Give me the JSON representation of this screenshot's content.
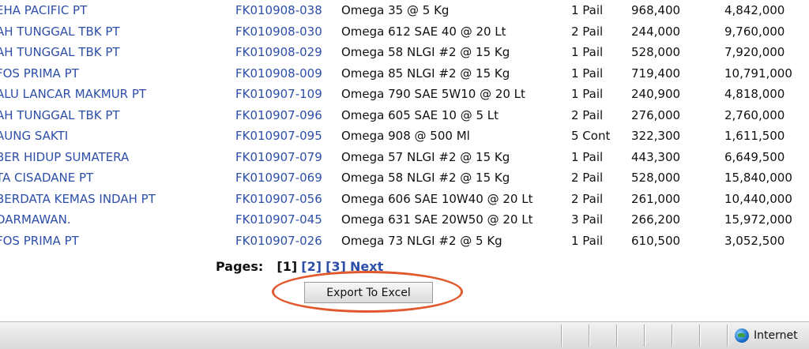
{
  "rows": [
    {
      "customer": "EHA PACIFIC PT",
      "invoice": "FK010908-038",
      "product": "Omega 35 @ 5 Kg",
      "qty": "1 Pail",
      "price": "968,400",
      "total": "4,842,000"
    },
    {
      "customer": "AH TUNGGAL TBK PT",
      "invoice": "FK010908-030",
      "product": "Omega 612 SAE 40 @ 20 Lt",
      "qty": "2 Pail",
      "price": "244,000",
      "total": "9,760,000"
    },
    {
      "customer": "AH TUNGGAL TBK PT",
      "invoice": "FK010908-029",
      "product": "Omega 58 NLGI #2 @ 15 Kg",
      "qty": "1 Pail",
      "price": "528,000",
      "total": "7,920,000"
    },
    {
      "customer": "FOS PRIMA PT",
      "invoice": "FK010908-009",
      "product": "Omega 85 NLGI #2 @ 15 Kg",
      "qty": "1 Pail",
      "price": "719,400",
      "total": "10,791,000"
    },
    {
      "customer": "ALU LANCAR MAKMUR PT",
      "invoice": "FK010907-109",
      "product": "Omega 790 SAE 5W10 @ 20 Lt",
      "qty": "1 Pail",
      "price": "240,900",
      "total": "4,818,000"
    },
    {
      "customer": "AH TUNGGAL TBK PT",
      "invoice": "FK010907-096",
      "product": "Omega 605 SAE 10 @ 5 Lt",
      "qty": "2 Pail",
      "price": "276,000",
      "total": "2,760,000"
    },
    {
      "customer": "AUNG SAKTI",
      "invoice": "FK010907-095",
      "product": "Omega 908 @ 500 Ml",
      "qty": "5 Cont",
      "price": "322,300",
      "total": "1,611,500"
    },
    {
      "customer": "BER HIDUP SUMATERA",
      "invoice": "FK010907-079",
      "product": "Omega 57 NLGI #2 @ 15 Kg",
      "qty": "1 Pail",
      "price": "443,300",
      "total": "6,649,500"
    },
    {
      "customer": "TA CISADANE PT",
      "invoice": "FK010907-069",
      "product": "Omega 58 NLGI #2 @ 15 Kg",
      "qty": "2 Pail",
      "price": "528,000",
      "total": "15,840,000"
    },
    {
      "customer": "BERDATA KEMAS INDAH PT",
      "invoice": "FK010907-056",
      "product": "Omega 606 SAE 10W40 @ 20 Lt",
      "qty": "2 Pail",
      "price": "261,000",
      "total": "10,440,000"
    },
    {
      "customer": "DARMAWAN.",
      "invoice": "FK010907-045",
      "product": "Omega 631 SAE 20W50 @ 20 Lt",
      "qty": "3 Pail",
      "price": "266,200",
      "total": "15,972,000"
    },
    {
      "customer": "FOS PRIMA PT",
      "invoice": "FK010907-026",
      "product": "Omega 73 NLGI #2 @ 5 Kg",
      "qty": "1 Pail",
      "price": "610,500",
      "total": "3,052,500"
    }
  ],
  "pager": {
    "label": "Pages:",
    "current": "[1]",
    "page2": "[2]",
    "page3": "[3]",
    "next": "Next"
  },
  "export_button": "Export To Excel",
  "statusbar": {
    "zone_label": "Internet",
    "zone_icon": "globe-icon"
  },
  "colors": {
    "link": "#2e4fa8",
    "highlight_ring": "#e2582d"
  }
}
